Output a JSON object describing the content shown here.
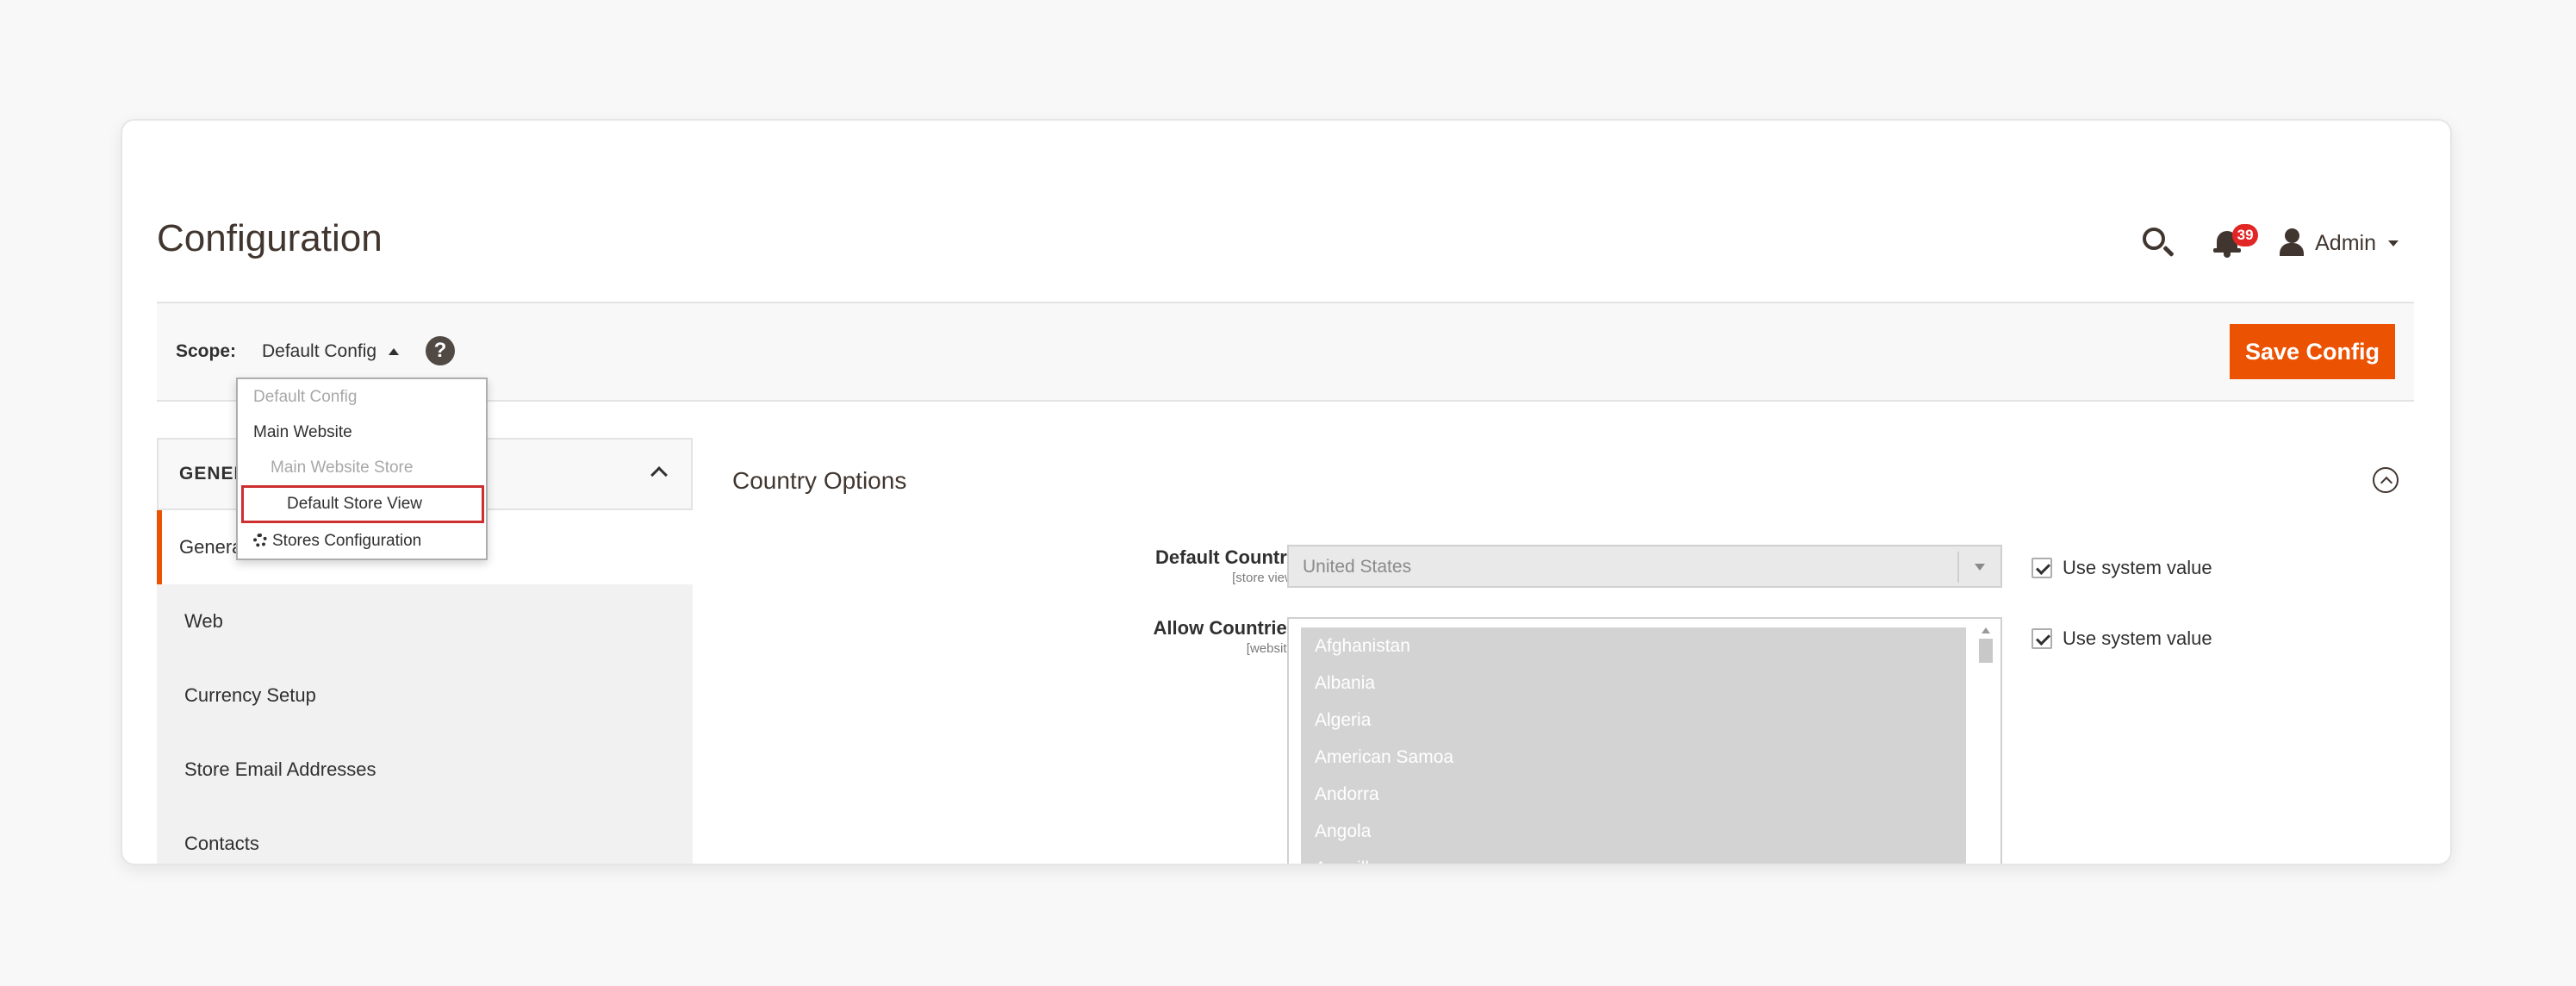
{
  "page": {
    "title": "Configuration"
  },
  "header": {
    "notification_count": "39",
    "user_name": "Admin"
  },
  "scope": {
    "label": "Scope:",
    "current": "Default Config"
  },
  "toolbar": {
    "save_label": "Save Config"
  },
  "scope_dropdown": {
    "items": [
      "Default Config",
      "Main Website",
      "Main Website Store",
      "Default Store View",
      "Stores Configuration"
    ]
  },
  "side_nav": {
    "section_label": "GENERAL",
    "items": [
      "General",
      "Web",
      "Currency Setup",
      "Store Email Addresses",
      "Contacts"
    ]
  },
  "section": {
    "title": "Country Options"
  },
  "fields": {
    "default_country": {
      "label": "Default Country",
      "scope": "[store view]",
      "value": "United States"
    },
    "allow_countries": {
      "label": "Allow Countries",
      "scope": "[website]",
      "options": [
        "Afghanistan",
        "Albania",
        "Algeria",
        "American Samoa",
        "Andorra",
        "Angola",
        "Anguilla"
      ]
    },
    "use_system_value": "Use system value"
  },
  "colors": {
    "accent": "#eb5202",
    "highlight_border": "#cc2f2f",
    "badge": "#e22626"
  }
}
